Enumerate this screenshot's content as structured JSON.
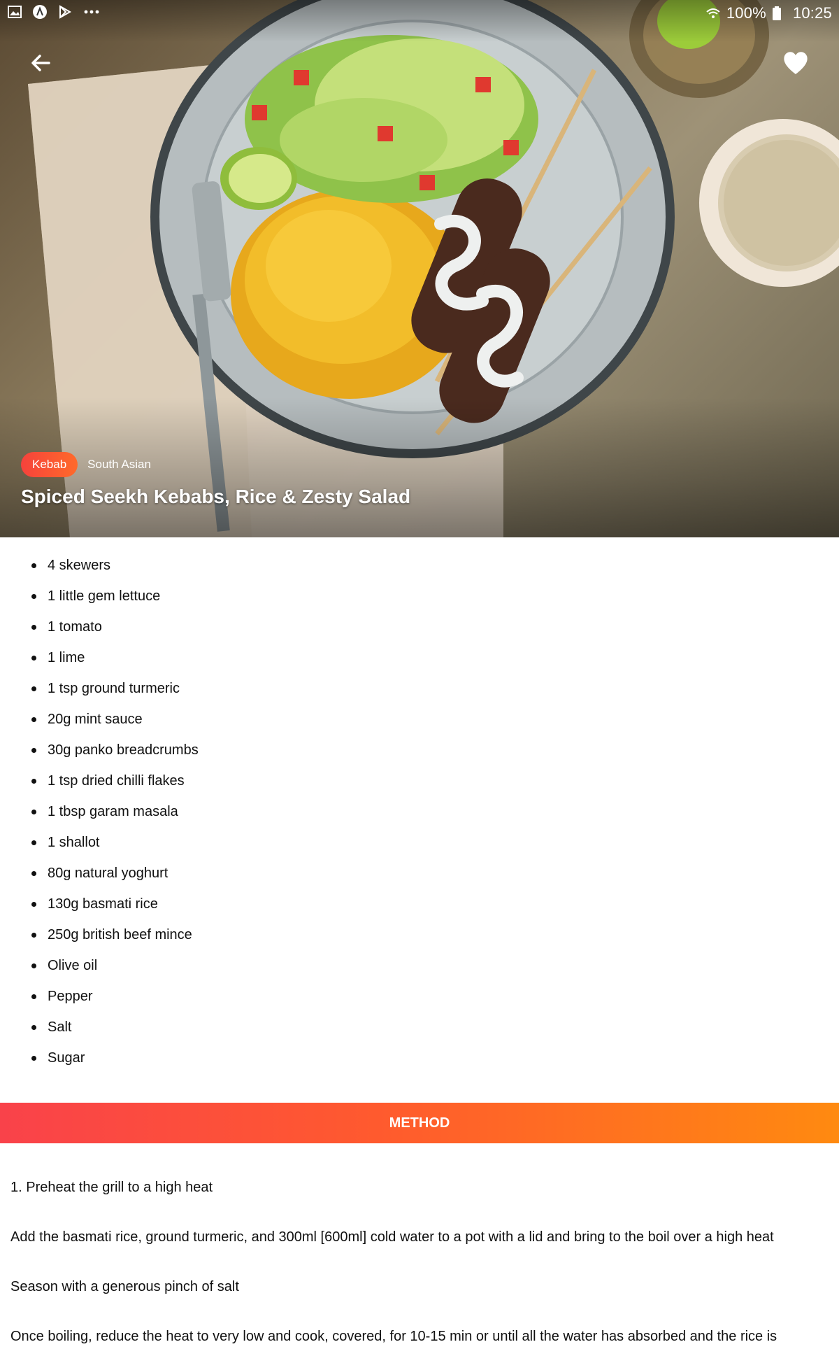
{
  "status_bar": {
    "left_icons": [
      "gallery-icon",
      "a-circle-icon",
      "play-store-icon",
      "more-dots-icon"
    ],
    "battery_percent": "100%",
    "time": "10:25"
  },
  "actions": {
    "back_icon": "back-arrow-icon",
    "favorite_icon": "heart-icon"
  },
  "recipe": {
    "tag_primary": "Kebab",
    "tag_secondary": "South Asian",
    "title": "Spiced Seekh Kebabs, Rice & Zesty Salad"
  },
  "ingredients": [
    "4 skewers",
    "1 little gem lettuce",
    "1 tomato",
    "1 lime",
    "1 tsp ground turmeric",
    "20g mint sauce",
    "30g panko breadcrumbs",
    "1 tsp dried chilli flakes",
    "1 tbsp garam masala",
    "1 shallot",
    "80g natural yoghurt",
    "130g basmati rice",
    "250g british beef mince",
    "Olive oil",
    "Pepper",
    "Salt",
    "Sugar"
  ],
  "method": {
    "heading": "METHOD",
    "steps": [
      "1. Preheat the grill to a high heat",
      "Add the basmati rice, ground turmeric, and 300ml [600ml] cold water to a pot with a lid and bring to the boil over a high heat",
      "Season with a generous pinch of salt",
      "Once boiling, reduce the heat to very low and cook, covered, for 10-15 min or until all the water has absorbed and the rice is"
    ]
  },
  "colors": {
    "accent_start": "#f9424a",
    "accent_end": "#ff8a10",
    "tag_primary": "#f5423c"
  }
}
